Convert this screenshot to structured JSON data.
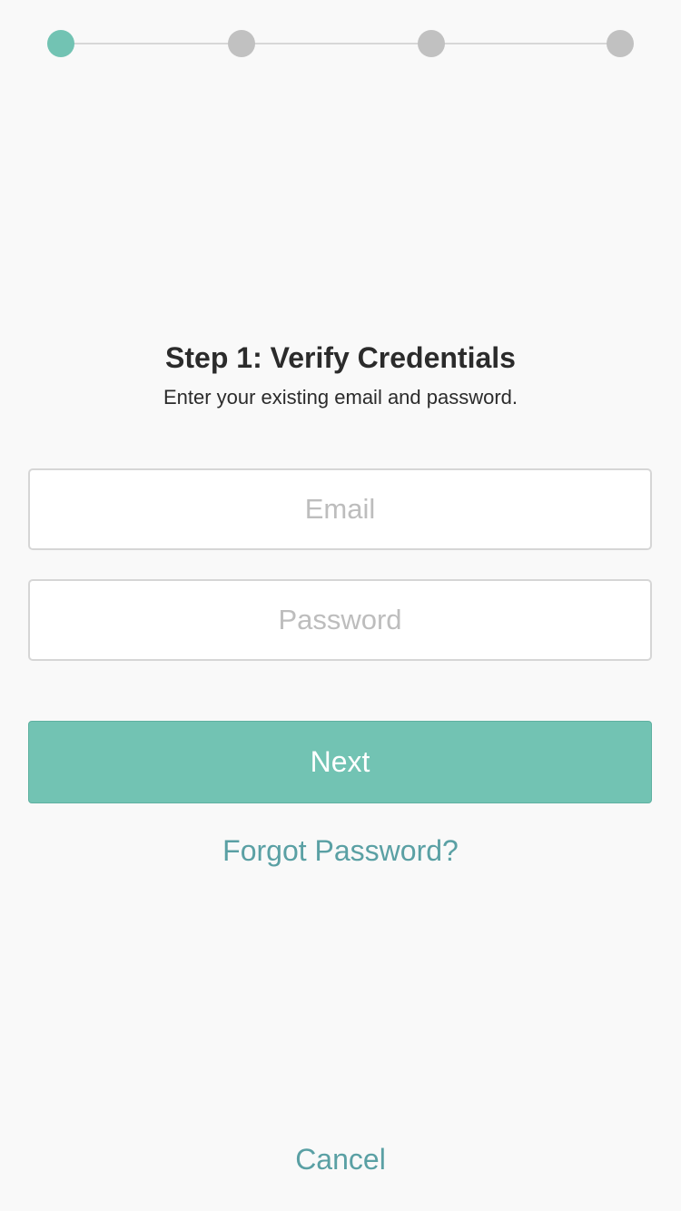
{
  "stepper": {
    "total_steps": 4,
    "current_step": 1,
    "active_color": "#72c3b3",
    "inactive_color": "#c1c1c1"
  },
  "heading": {
    "title": "Step 1: Verify Credentials",
    "subtitle": "Enter your existing email and password."
  },
  "form": {
    "email": {
      "value": "",
      "placeholder": "Email"
    },
    "password": {
      "value": "",
      "placeholder": "Password"
    },
    "next_label": "Next",
    "forgot_label": "Forgot Password?"
  },
  "footer": {
    "cancel_label": "Cancel"
  },
  "colors": {
    "background": "#f9f9f9",
    "primary": "#72c3b3",
    "link": "#5aa0a4"
  }
}
